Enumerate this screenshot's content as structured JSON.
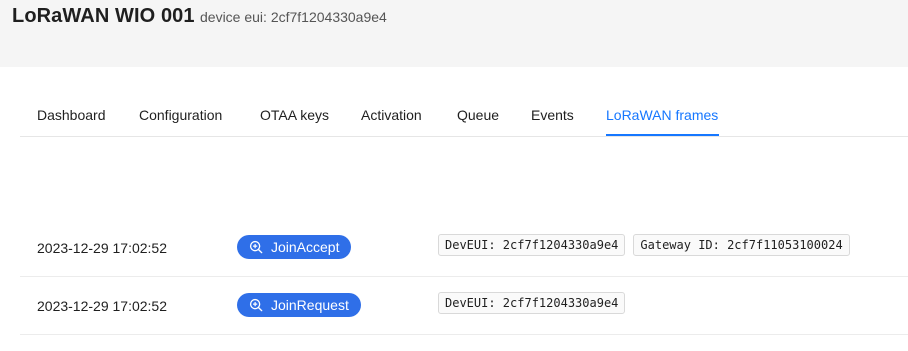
{
  "header": {
    "title": "LoRaWAN WIO 001",
    "subtitle": "device eui: 2cf7f1204330a9e4"
  },
  "tabs": [
    {
      "label": "Dashboard"
    },
    {
      "label": "Configuration"
    },
    {
      "label": "OTAA keys"
    },
    {
      "label": "Activation"
    },
    {
      "label": "Queue"
    },
    {
      "label": "Events"
    },
    {
      "label": "LoRaWAN frames",
      "active": true
    }
  ],
  "frames": [
    {
      "time": "2023-12-29 17:02:52",
      "type": "JoinAccept",
      "tags": [
        "DevEUI: 2cf7f1204330a9e4",
        "Gateway ID: 2cf7f11053100024"
      ]
    },
    {
      "time": "2023-12-29 17:02:52",
      "type": "JoinRequest",
      "tags": [
        "DevEUI: 2cf7f1204330a9e4"
      ]
    }
  ],
  "colors": {
    "accent": "#1677ff",
    "pill": "#2f6fe8",
    "header_bg": "#f5f5f5"
  },
  "icons": {
    "frame_type": "zoom-in-icon"
  }
}
